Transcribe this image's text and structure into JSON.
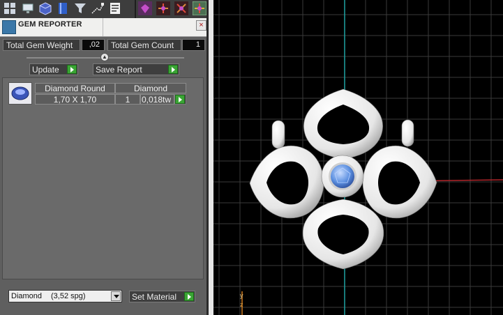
{
  "panel": {
    "title": "GEM REPORTER",
    "close_glyph": "×"
  },
  "toolbar": {
    "icons": [
      "window-layout-icon",
      "screen-icon",
      "cube-view-icon",
      "book-icon",
      "filter-icon",
      "select-tool-icon",
      "properties-icon",
      "gem-tool-icon",
      "gizmo-icon",
      "gizmo-alt-icon",
      "gizmo-active-icon"
    ]
  },
  "summary": {
    "weight_label": "Total Gem Weight",
    "weight_value": ",02",
    "count_label": "Total Gem Count",
    "count_value": "1"
  },
  "buttons": {
    "update": "Update",
    "save_report": "Save Report",
    "set_material": "Set Material"
  },
  "gem_table": {
    "headers": [
      "Diamond Round",
      "Diamond"
    ],
    "rows": [
      {
        "size": "1,70 X 1,70",
        "count": "1",
        "weight": "0,018tw"
      }
    ]
  },
  "material": {
    "name": "Diamond",
    "spg": "(3,52 spg)"
  },
  "viewport": {
    "axis_label": "Y\nZ",
    "colors": {
      "grid": "#3a3a3a",
      "x_axis": "#b3262b",
      "y_axis": "#1fa3a3",
      "model": "#f4f4f4",
      "gem": "#5b8fe0"
    }
  }
}
